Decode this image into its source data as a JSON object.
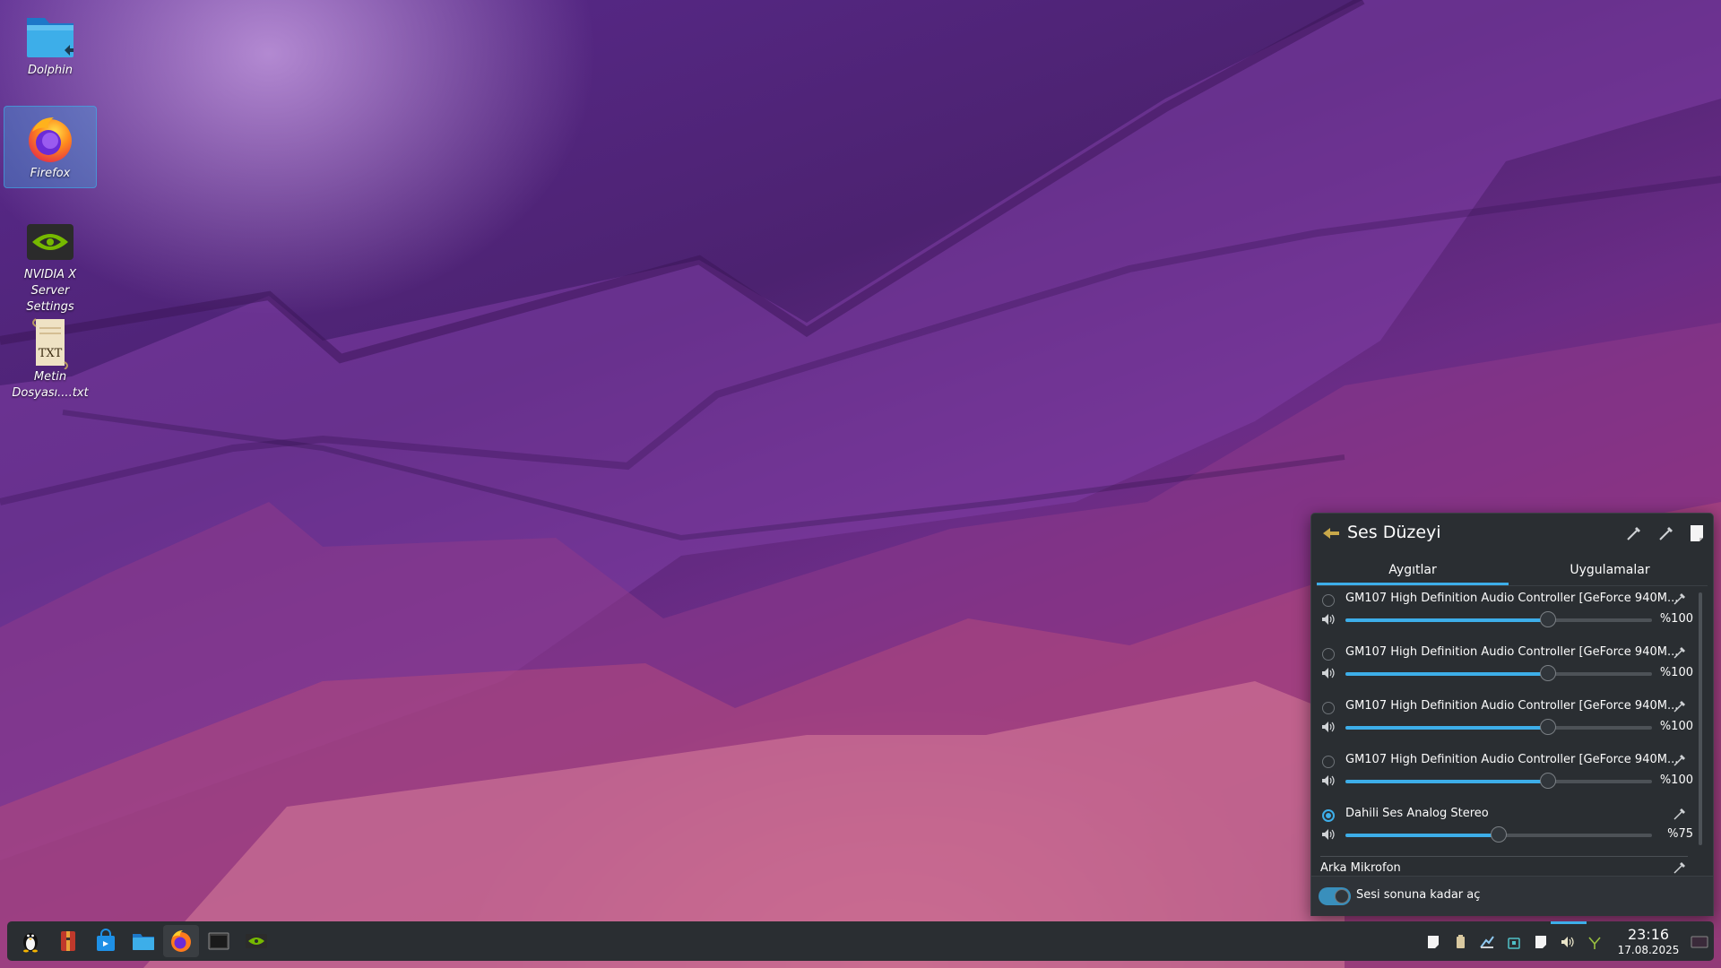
{
  "desktop": {
    "icons": [
      {
        "label": "Dolphin"
      },
      {
        "label": "Firefox"
      },
      {
        "label": "NVIDIA X Server Settings"
      },
      {
        "label": "Metin Dosyası....txt"
      }
    ]
  },
  "audio_popup": {
    "title": "Ses Düzeyi",
    "tabs": [
      {
        "label": "Aygıtlar",
        "active": true
      },
      {
        "label": "Uygulamalar",
        "active": false
      }
    ],
    "devices": [
      {
        "name": "GM107 High Definition Audio Controller [GeForce 940M...",
        "volume_label": "%100",
        "slider_fraction": 0.66,
        "default": false
      },
      {
        "name": "GM107 High Definition Audio Controller [GeForce 940M...",
        "volume_label": "%100",
        "slider_fraction": 0.66,
        "default": false
      },
      {
        "name": "GM107 High Definition Audio Controller [GeForce 940M...",
        "volume_label": "%100",
        "slider_fraction": 0.66,
        "default": false
      },
      {
        "name": "GM107 High Definition Audio Controller [GeForce 940M...",
        "volume_label": "%100",
        "slider_fraction": 0.66,
        "default": false
      },
      {
        "name": "Dahili Ses Analog Stereo",
        "volume_label": "%75",
        "slider_fraction": 0.5,
        "default": true
      }
    ],
    "section_mic": "Arka Mikrofon",
    "footer_toggle_label": "Sesi sonuna kadar aç",
    "footer_toggle_on": true
  },
  "taskbar": {
    "apps": [
      "start-menu",
      "archive-manager",
      "discover",
      "dolphin",
      "firefox",
      "terminal",
      "nvidia-settings"
    ],
    "tray": [
      "clipboard",
      "battery",
      "network",
      "vaults",
      "notes",
      "volume",
      "updates"
    ],
    "time": "23:16",
    "date": "17.08.2025"
  },
  "colors": {
    "accent": "#3daee9",
    "panel_bg": "#2a2e32",
    "wall_purple": "#5a2a8e",
    "wall_pink": "#e38ca0"
  }
}
